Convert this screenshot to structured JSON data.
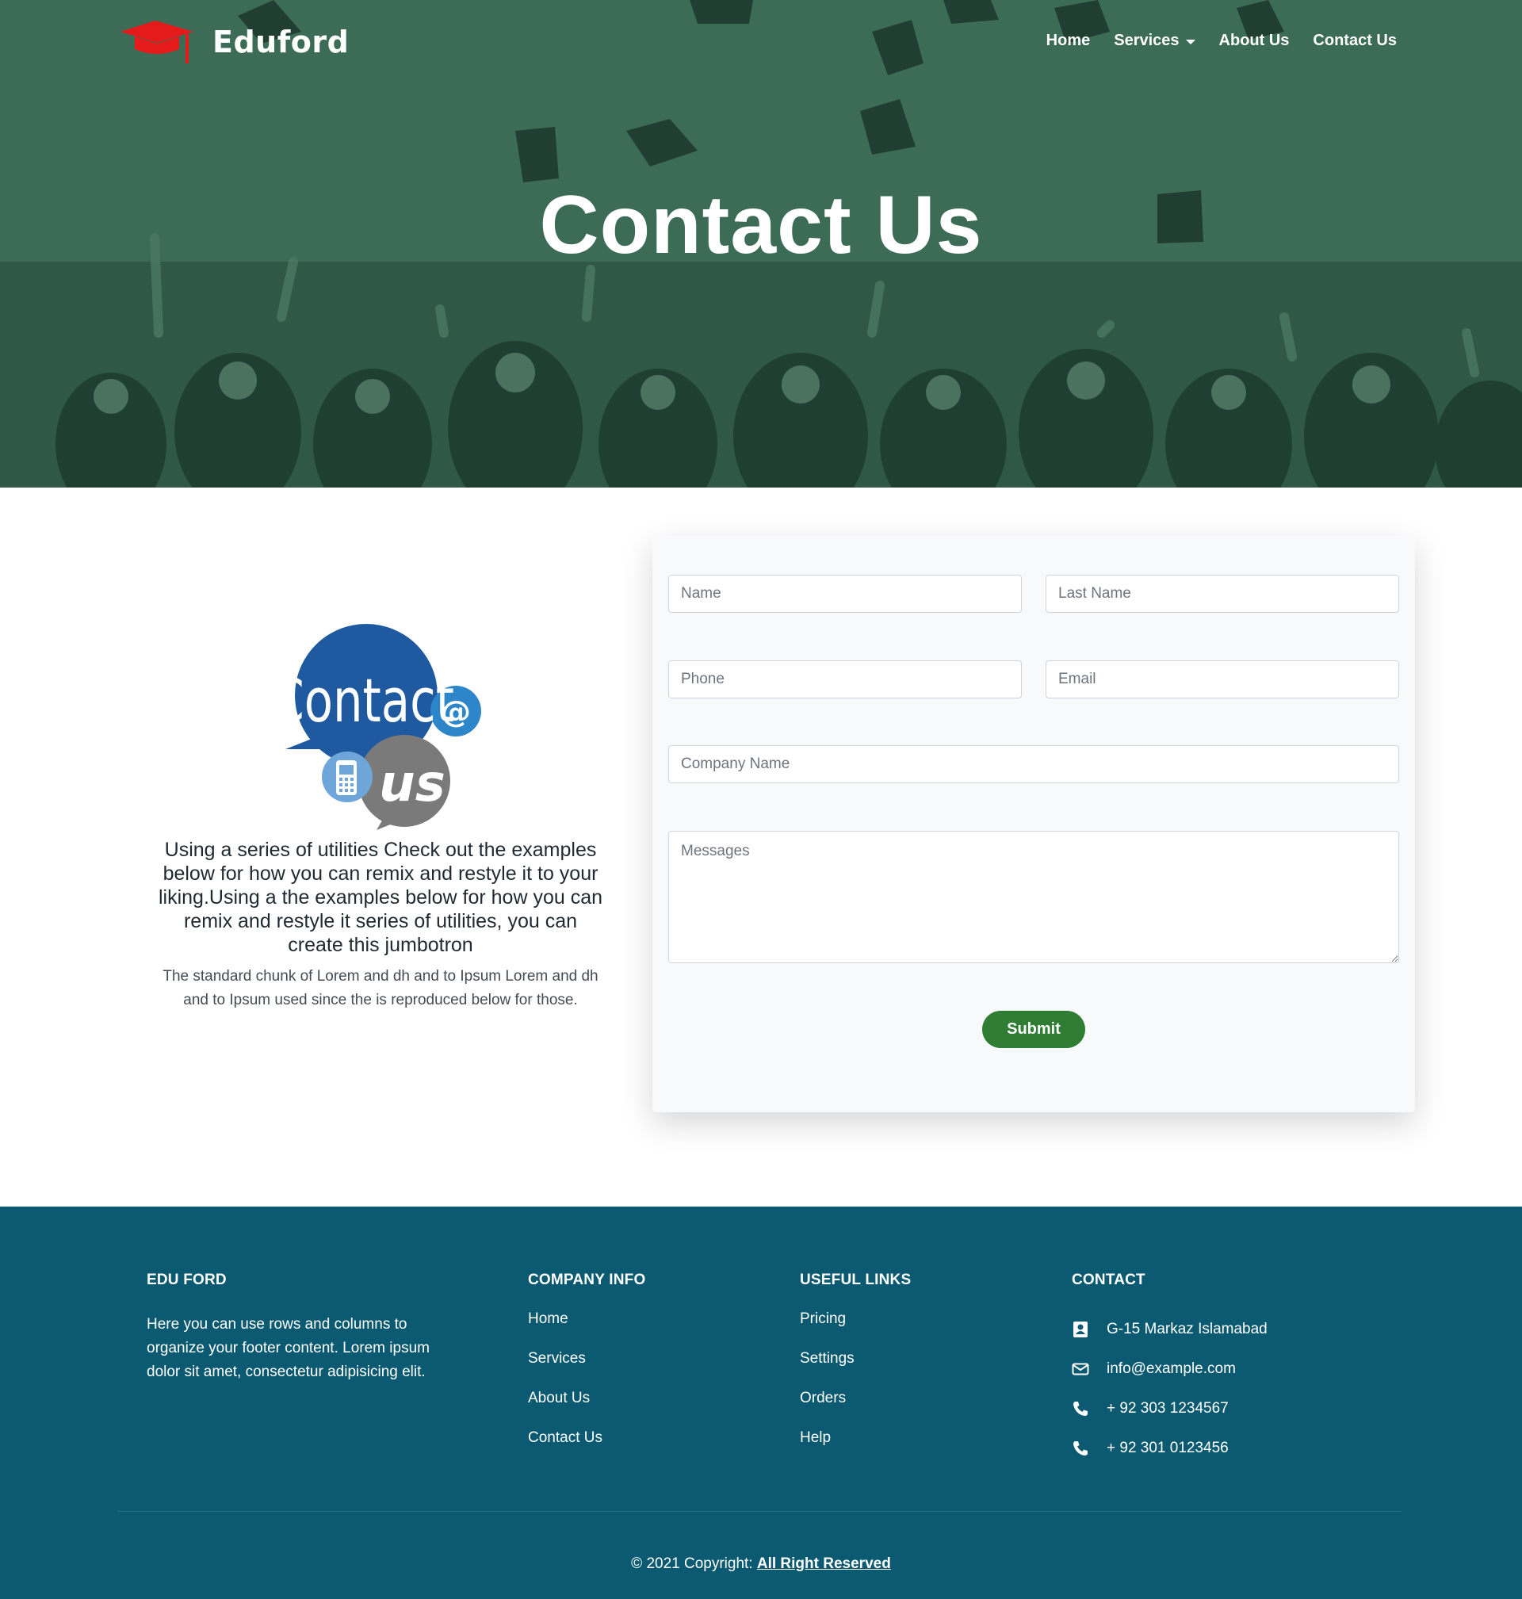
{
  "brand": {
    "name": "Eduford",
    "logo_icon": "graduation-cap-icon",
    "logo_color": "#e51b1b"
  },
  "nav": {
    "items": [
      {
        "label": "Home"
      },
      {
        "label": "Services"
      },
      {
        "label": "About Us"
      },
      {
        "label": "Contact Us"
      }
    ]
  },
  "hero": {
    "title": "Contact Us",
    "overlay_color": "#2f5a46"
  },
  "intro": {
    "lead": "Using a series of utilities Check out the examples below for how you can remix and restyle it to your liking.Using a the examples below for how you can remix and restyle it series of utilities, you can create this jumbotron",
    "sub": "The standard chunk of Lorem and dh and to Ipsum Lorem and dh and to Ipsum used since the is reproduced below for those.",
    "image": {
      "word1": "Contact",
      "word2": "us",
      "at": "@"
    }
  },
  "form": {
    "name_placeholder": "Name",
    "last_name_placeholder": "Last Name",
    "phone_placeholder": "Phone",
    "email_placeholder": "Email",
    "company_placeholder": "Company Name",
    "message_placeholder": "Messages",
    "submit_label": "Submit",
    "submit_color": "#2e7d32"
  },
  "footer": {
    "background": "#0b5a71",
    "about": {
      "heading": "EDU FORD",
      "text": "Here you can use rows and columns to organize your footer content. Lorem ipsum dolor sit amet, consectetur adipisicing elit."
    },
    "company": {
      "heading": "COMPANY INFO",
      "links": [
        "Home",
        "Services",
        "About Us",
        "Contact Us"
      ]
    },
    "useful": {
      "heading": "USEFUL LINKS",
      "links": [
        "Pricing",
        "Settings",
        "Orders",
        "Help"
      ]
    },
    "contact": {
      "heading": "CONTACT",
      "items": [
        {
          "icon": "address-card-icon",
          "text": "G-15 Markaz Islamabad"
        },
        {
          "icon": "envelope-icon",
          "text": "info@example.com"
        },
        {
          "icon": "phone-icon",
          "text": "+ 92 303 1234567"
        },
        {
          "icon": "phone-icon",
          "text": "+ 92 301 0123456"
        }
      ]
    },
    "copyright_prefix": "© 2021 Copyright:",
    "copyright_link": "All Right Reserved"
  }
}
